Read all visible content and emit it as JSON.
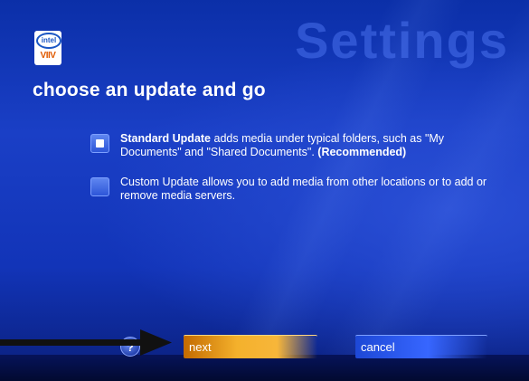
{
  "window": {
    "watermark_title": "Settings",
    "heading": "choose an update and go"
  },
  "logo": {
    "line1": "intel",
    "line2": "VIIV"
  },
  "options": [
    {
      "selected": true,
      "title": "Standard Update",
      "desc": " adds media under typical folders, such as \"My Documents\" and \"Shared Documents\". ",
      "suffix": "(Recommended)"
    },
    {
      "selected": false,
      "title": "",
      "desc": "Custom Update allows you to add media from other locations or to add or remove media servers.",
      "suffix": ""
    }
  ],
  "buttons": {
    "help_label": "?",
    "next_label": "next",
    "cancel_label": "cancel"
  },
  "colors": {
    "background": "#1234b8",
    "next_accent": "#f4b12c",
    "cancel_accent": "#3766ff",
    "annotation_arrow": "#111111"
  },
  "icons": {
    "logo": "intel-viiv-logo-icon",
    "help": "question-mark-icon",
    "annotation": "arrow-right-icon"
  }
}
